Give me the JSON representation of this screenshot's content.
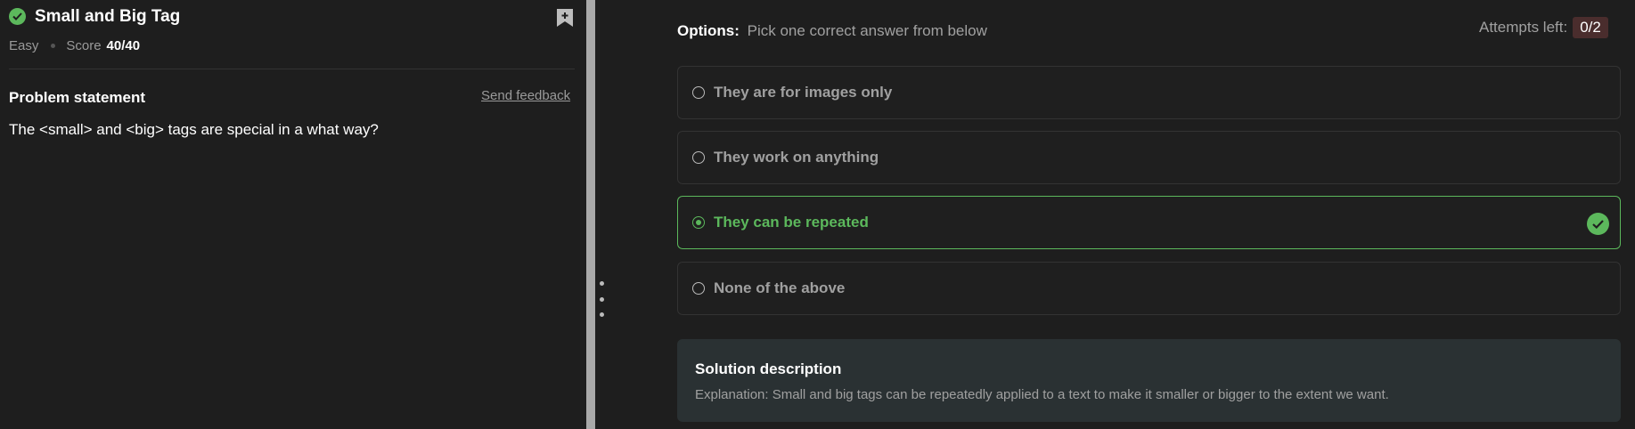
{
  "problem": {
    "title": "Small and Big Tag",
    "difficulty": "Easy",
    "score_label": "Score",
    "score_value": "40/40",
    "status_icon": "check-circle-icon",
    "bookmark_icon": "bookmark-plus-icon"
  },
  "statement": {
    "heading": "Problem statement",
    "feedback_label": "Send feedback",
    "text": "The <small> and <big> tags are special in a what way?"
  },
  "options_section": {
    "label": "Options:",
    "hint": "Pick one correct answer from below",
    "attempts_label": "Attempts left:",
    "attempts_value": "0/2",
    "items": [
      {
        "text": "They are for images only",
        "selected": false,
        "correct": false
      },
      {
        "text": "They work on anything",
        "selected": false,
        "correct": false
      },
      {
        "text": "They can be repeated",
        "selected": true,
        "correct": true
      },
      {
        "text": "None of the above",
        "selected": false,
        "correct": false
      }
    ]
  },
  "solution": {
    "title": "Solution description",
    "text": "Explanation: Small and big tags can be repeatedly applied to a text to make it smaller or bigger to the extent we want."
  },
  "colors": {
    "accent_green": "#5cb85c",
    "background": "#1e1e1e",
    "attempts_badge": "#4a2d2d",
    "solution_bg": "#2a3133"
  }
}
